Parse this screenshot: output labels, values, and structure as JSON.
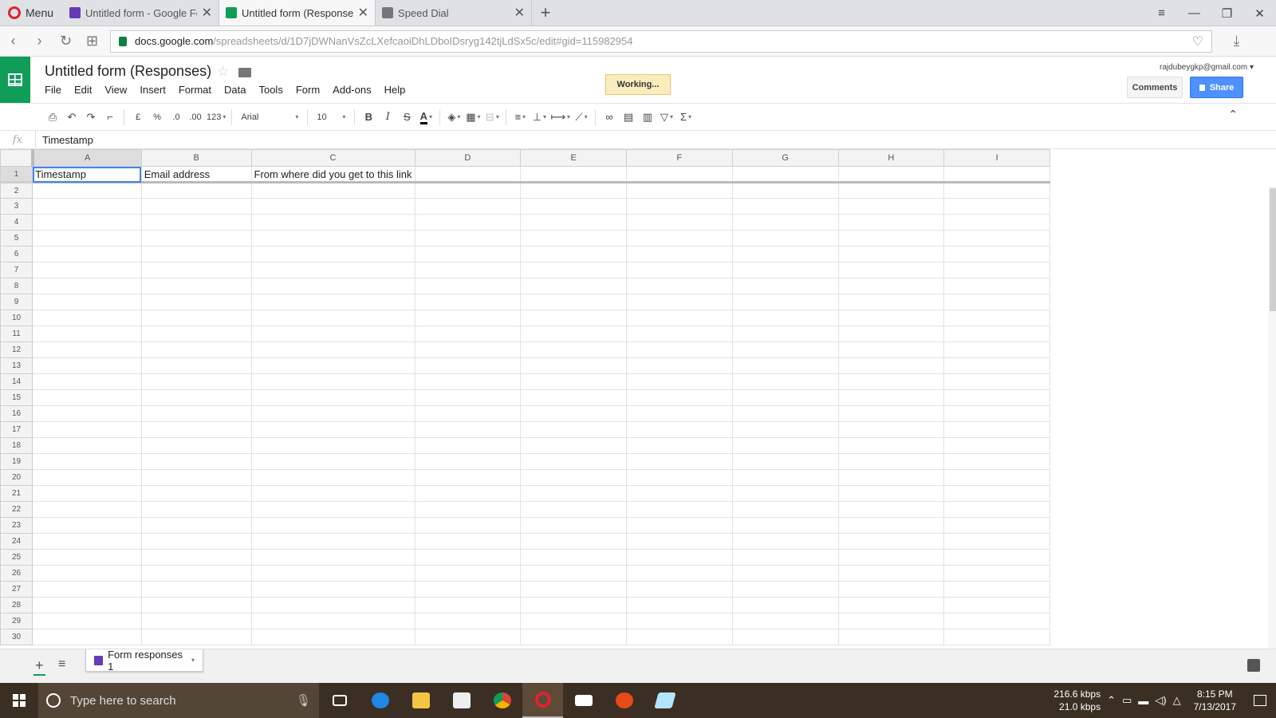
{
  "browser": {
    "menu_label": "Menu",
    "tabs": [
      {
        "title": "Untitled form - Google Forms",
        "icon": "forms-icon"
      },
      {
        "title": "Untitled form (Responses)",
        "icon": "sheets-icon"
      },
      {
        "title": "Speed Dial",
        "icon": "speed-dial-icon"
      }
    ],
    "url_domain": "docs.google.com",
    "url_path": "/spreadsheets/d/1D7jDWNanVsZcLXefcaoiDhLDboIDsryg142tjLdSx5c/edit#gid=115982954"
  },
  "doc": {
    "title": "Untitled form (Responses)",
    "menus": [
      "File",
      "Edit",
      "View",
      "Insert",
      "Format",
      "Data",
      "Tools",
      "Form",
      "Add-ons",
      "Help"
    ],
    "status": "Working...",
    "account": "rajdubeygkp@gmail.com",
    "comments_label": "Comments",
    "share_label": "Share"
  },
  "toolbar": {
    "currency": "£",
    "percent": "%",
    "dec_decrease": ".0",
    "dec_increase": ".00",
    "more_formats": "123",
    "font": "Arial",
    "font_size": "10",
    "bold": "B",
    "italic": "I",
    "strike": "S",
    "text_color": "A",
    "sum": "Σ"
  },
  "formula": {
    "fx": "fx",
    "value": "Timestamp"
  },
  "grid": {
    "columns": [
      "A",
      "B",
      "C",
      "D",
      "E",
      "F",
      "G",
      "H",
      "I"
    ],
    "selected_cell": "A1",
    "header_row": [
      "Timestamp",
      "Email address",
      "From where did you get to this link",
      "",
      "",
      "",
      "",
      "",
      ""
    ],
    "row_count": 30
  },
  "sheets": {
    "active": "Form responses 1"
  },
  "taskbar": {
    "search_placeholder": "Type here to search",
    "net_up": "216.6 kbps",
    "net_down": "21.0 kbps",
    "time": "8:15 PM",
    "date": "7/13/2017"
  }
}
